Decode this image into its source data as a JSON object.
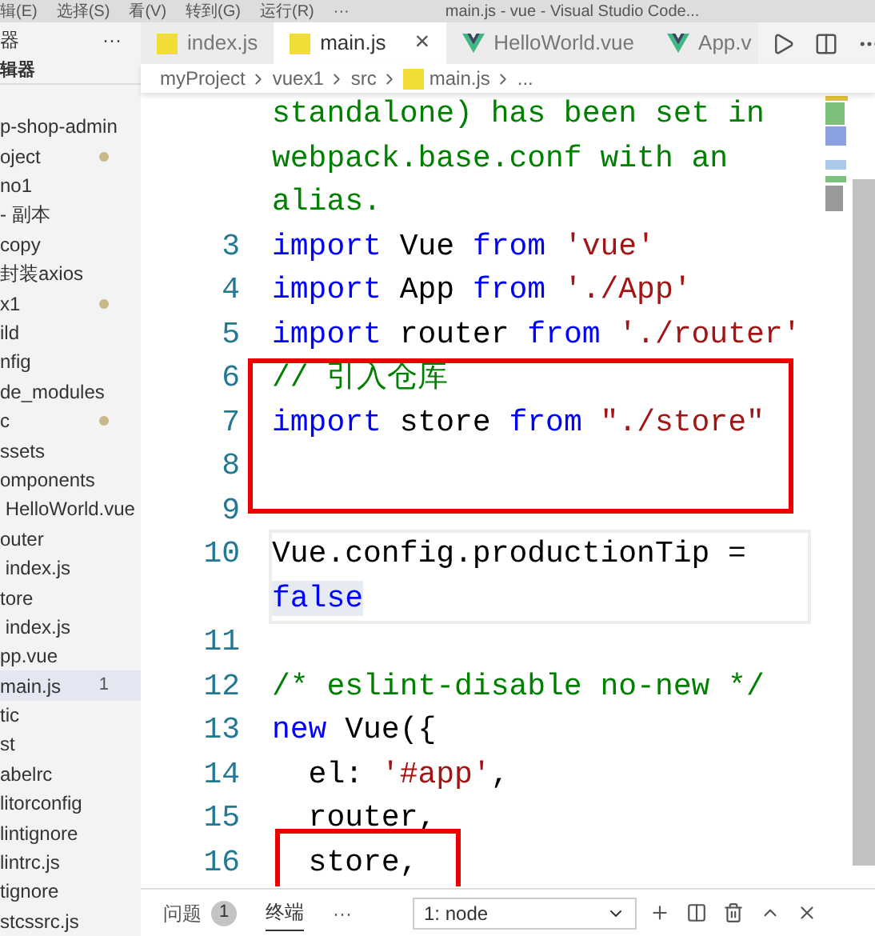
{
  "title_bar": {
    "menus": [
      "辑(E)",
      "选择(S)",
      "看(V)",
      "转到(G)",
      "运行(R)",
      "···"
    ],
    "title": "main.js - vue - Visual Studio Code..."
  },
  "sidebar": {
    "header": "器",
    "more": "···",
    "section": "辑器",
    "items": [
      {
        "label": "p-shop-admin",
        "modified": false,
        "selected": false
      },
      {
        "label": "oject",
        "modified": true,
        "selected": false
      },
      {
        "label": "no1",
        "modified": false,
        "selected": false
      },
      {
        "label": "- 副本",
        "modified": false,
        "selected": false
      },
      {
        "label": "copy",
        "modified": false,
        "selected": false
      },
      {
        "label": "封装axios",
        "modified": false,
        "selected": false
      },
      {
        "label": "x1",
        "modified": true,
        "selected": false
      },
      {
        "label": "ild",
        "modified": false,
        "selected": false
      },
      {
        "label": "nfig",
        "modified": false,
        "selected": false
      },
      {
        "label": "de_modules",
        "modified": false,
        "selected": false
      },
      {
        "label": "c",
        "modified": true,
        "selected": false
      },
      {
        "label": "ssets",
        "modified": false,
        "selected": false
      },
      {
        "label": "omponents",
        "modified": false,
        "selected": false
      },
      {
        "label": " HelloWorld.vue",
        "modified": false,
        "selected": false
      },
      {
        "label": "outer",
        "modified": false,
        "selected": false
      },
      {
        "label": " index.js",
        "modified": false,
        "selected": false
      },
      {
        "label": "tore",
        "modified": false,
        "selected": false
      },
      {
        "label": " index.js",
        "modified": false,
        "selected": false
      },
      {
        "label": "pp.vue",
        "modified": false,
        "selected": false
      },
      {
        "label": "main.js",
        "modified": false,
        "selected": true,
        "badge": "1"
      },
      {
        "label": "tic",
        "modified": false,
        "selected": false
      },
      {
        "label": "st",
        "modified": false,
        "selected": false
      },
      {
        "label": "abelrc",
        "modified": false,
        "selected": false
      },
      {
        "label": "litorconfig",
        "modified": false,
        "selected": false
      },
      {
        "label": "lintignore",
        "modified": false,
        "selected": false
      },
      {
        "label": "lintrc.js",
        "modified": false,
        "selected": false
      },
      {
        "label": "tignore",
        "modified": false,
        "selected": false
      },
      {
        "label": "stcssrc.js",
        "modified": false,
        "selected": false
      }
    ]
  },
  "tabs": [
    {
      "label": "index.js",
      "kind": "js",
      "selected": false
    },
    {
      "label": "main.js",
      "kind": "js",
      "selected": true,
      "close": "×"
    },
    {
      "label": "HelloWorld.vue",
      "kind": "vue",
      "selected": false
    },
    {
      "label": "App.v",
      "kind": "vue",
      "selected": false
    }
  ],
  "breadcrumb": [
    {
      "label": "myProject",
      "kind": "folder"
    },
    {
      "label": "vuex1",
      "kind": "folder"
    },
    {
      "label": "src",
      "kind": "folder"
    },
    {
      "label": "main.js",
      "kind": "js"
    },
    {
      "label": "...",
      "kind": "folder"
    }
  ],
  "code": [
    {
      "current": false,
      "rows": [
        [
          {
            "text": "standalone) has been set in",
            "kind": "comment"
          }
        ],
        [
          {
            "text": "webpack.base.conf with an",
            "kind": "comment"
          }
        ],
        [
          {
            "text": "alias.",
            "kind": "comment"
          }
        ]
      ]
    },
    {
      "number": "3",
      "current": false,
      "rows": [
        [
          {
            "text": "import",
            "kind": "keyword"
          },
          {
            "text": " Vue ",
            "kind": "plain"
          },
          {
            "text": "from",
            "kind": "keyword"
          },
          {
            "text": " ",
            "kind": "plain"
          },
          {
            "text": "'vue'",
            "kind": "string"
          }
        ]
      ]
    },
    {
      "number": "4",
      "current": false,
      "rows": [
        [
          {
            "text": "import",
            "kind": "keyword"
          },
          {
            "text": " App ",
            "kind": "plain"
          },
          {
            "text": "from",
            "kind": "keyword"
          },
          {
            "text": " ",
            "kind": "plain"
          },
          {
            "text": "'./App'",
            "kind": "string"
          }
        ]
      ]
    },
    {
      "number": "5",
      "current": false,
      "rows": [
        [
          {
            "text": "import",
            "kind": "keyword"
          },
          {
            "text": " router ",
            "kind": "plain"
          },
          {
            "text": "from",
            "kind": "keyword"
          },
          {
            "text": " ",
            "kind": "plain"
          },
          {
            "text": "'./router'",
            "kind": "string"
          }
        ]
      ]
    },
    {
      "number": "6",
      "current": false,
      "rows": [
        [
          {
            "text": "// 引入仓库",
            "kind": "comment"
          }
        ]
      ]
    },
    {
      "number": "7",
      "current": false,
      "rows": [
        [
          {
            "text": "import",
            "kind": "keyword"
          },
          {
            "text": " store ",
            "kind": "plain"
          },
          {
            "text": "from",
            "kind": "keyword"
          },
          {
            "text": " ",
            "kind": "plain"
          },
          {
            "text": "\"./store\"",
            "kind": "string"
          }
        ]
      ]
    },
    {
      "number": "8",
      "current": false,
      "rows": [
        []
      ]
    },
    {
      "number": "9",
      "current": false,
      "rows": [
        []
      ]
    },
    {
      "number": "10",
      "current": true,
      "rows": [
        [
          {
            "text": "Vue.config.productionTip =",
            "kind": "plain"
          }
        ],
        [
          {
            "text": "false",
            "kind": "selection"
          }
        ]
      ]
    },
    {
      "number": "11",
      "current": false,
      "rows": [
        []
      ]
    },
    {
      "number": "12",
      "current": false,
      "rows": [
        [
          {
            "text": "/* eslint-disable no-new */",
            "kind": "comment"
          }
        ]
      ]
    },
    {
      "number": "13",
      "current": false,
      "rows": [
        [
          {
            "text": "new",
            "kind": "keyword"
          },
          {
            "text": " Vue({",
            "kind": "plain"
          }
        ]
      ]
    },
    {
      "number": "14",
      "current": false,
      "rows": [
        [
          {
            "text": "  el: ",
            "kind": "plain"
          },
          {
            "text": "'#app'",
            "kind": "string"
          },
          {
            "text": ",",
            "kind": "plain"
          }
        ]
      ]
    },
    {
      "number": "15",
      "current": false,
      "rows": [
        [
          {
            "text": "  router,",
            "kind": "plain"
          }
        ]
      ]
    },
    {
      "number": "16",
      "current": false,
      "rows": [
        [
          {
            "text": "  store,",
            "kind": "plain"
          }
        ]
      ]
    }
  ],
  "panel": {
    "tabs": [
      {
        "label": "问题",
        "badge": "1",
        "selected": false
      },
      {
        "label": "终端",
        "selected": true
      }
    ],
    "more": "···",
    "terminal_select": "1: node"
  }
}
